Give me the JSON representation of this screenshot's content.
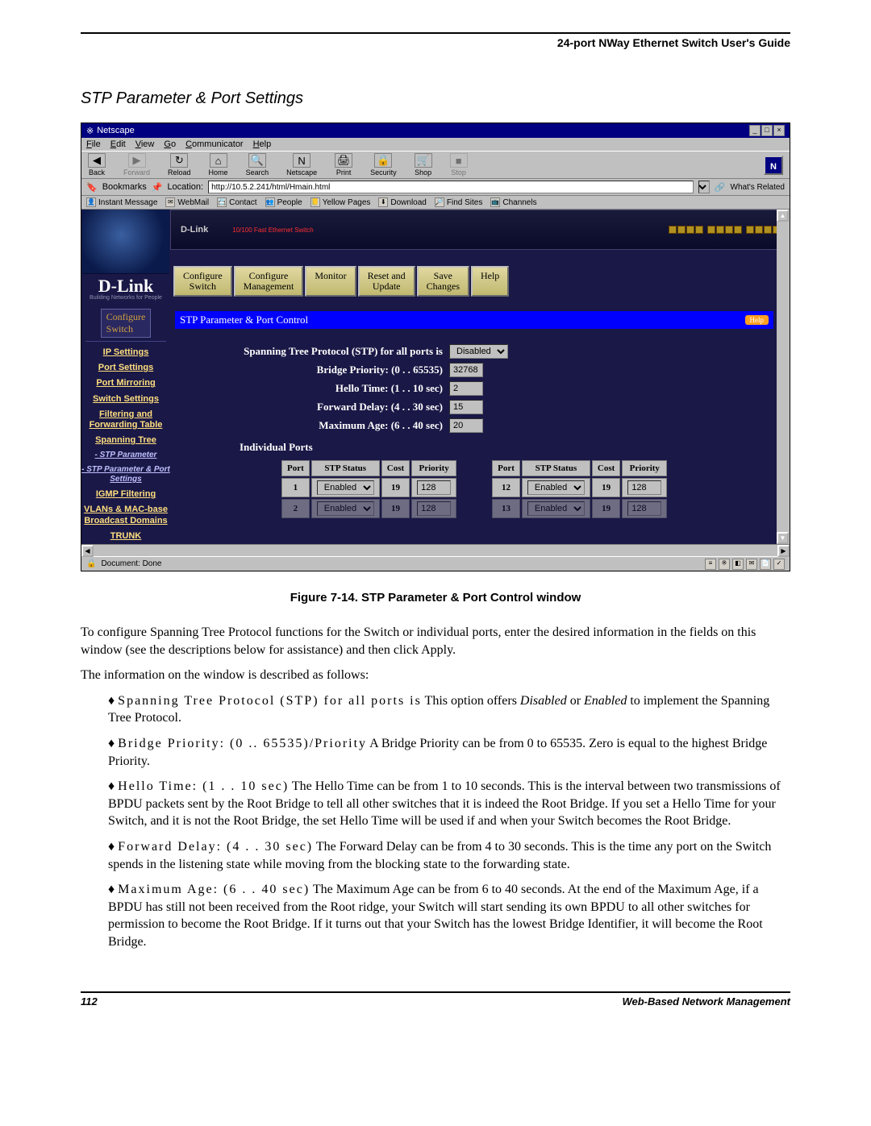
{
  "doc": {
    "header": "24-port NWay Ethernet Switch User's Guide",
    "section_title": "STP Parameter & Port Settings",
    "caption": "Figure 7-14.  STP Parameter & Port Control window",
    "para1": "To configure Spanning Tree Protocol functions for the Switch or individual ports, enter the desired information in the fields on this window (see the descriptions below for assistance) and then click Apply.",
    "para2": "The information on the window is described as follows:",
    "bullets": [
      {
        "term": "Spanning Tree Protocol (STP) for all ports is",
        "rest": "  This option offers Disabled or Enabled to implement the Spanning Tree Protocol.",
        "em1": "Disabled",
        "em2": "Enabled"
      },
      {
        "term": "Bridge Priority: (0 .. 65535)/Priority",
        "rest": "  A Bridge Priority can be from 0 to 65535. Zero is equal to the highest Bridge Priority."
      },
      {
        "term": "Hello Time: (1 . . 10 sec)",
        "rest": "  The Hello Time can be from 1 to 10 seconds. This is the interval between two transmissions of BPDU packets sent by the Root Bridge to tell all other switches that it is indeed the Root Bridge. If you set a Hello Time for your Switch, and it is not the Root Bridge, the set Hello Time will be used if and when your Switch becomes the Root Bridge."
      },
      {
        "term": "Forward Delay: (4 . . 30 sec)",
        "rest": "  The Forward Delay can be from 4 to 30 seconds. This is the time any port on the Switch spends in the listening state while moving from the blocking state to the forwarding state."
      },
      {
        "term": "Maximum Age: (6 . . 40 sec)",
        "rest": "  The Maximum Age can be from 6 to 40 seconds. At the end of the Maximum Age, if a BPDU has still not been received from the Root ridge, your Switch will start sending its own BPDU to all other switches for permission to become the Root Bridge. If it turns out that your Switch has the lowest Bridge Identifier, it will become the Root Bridge."
      }
    ],
    "footer_page": "112",
    "footer_right": "Web-Based Network Management"
  },
  "win": {
    "title": "Netscape",
    "menu": [
      "File",
      "Edit",
      "View",
      "Go",
      "Communicator",
      "Help"
    ],
    "tools": [
      {
        "label": "Back",
        "icon": "◀"
      },
      {
        "label": "Forward",
        "icon": "▶"
      },
      {
        "label": "Reload",
        "icon": "↻"
      },
      {
        "label": "Home",
        "icon": "⌂"
      },
      {
        "label": "Search",
        "icon": "🔍"
      },
      {
        "label": "Netscape",
        "icon": "N"
      },
      {
        "label": "Print",
        "icon": "🖨"
      },
      {
        "label": "Security",
        "icon": "🔒"
      },
      {
        "label": "Shop",
        "icon": "🛒"
      },
      {
        "label": "Stop",
        "icon": "■"
      }
    ],
    "bookmarks": "Bookmarks",
    "loc_label": "Location:",
    "loc_value": "http://10.5.2.241/html/Hmain.html",
    "related": "What's Related",
    "linkbar": [
      "Instant Message",
      "WebMail",
      "Contact",
      "People",
      "Yellow Pages",
      "Download",
      "Find Sites",
      "Channels"
    ],
    "status": "Document: Done"
  },
  "page": {
    "brand": "D-Link",
    "tagline": "Building Networks for People",
    "top_btn": "Configure\nSwitch",
    "side": [
      "IP Settings",
      "Port Settings",
      "Port Mirroring",
      "Switch Settings",
      "Filtering and Forwarding Table",
      "Spanning Tree"
    ],
    "side_sub": [
      "- STP Parameter",
      "- STP Parameter & Port Settings"
    ],
    "side_rest": [
      "IGMP Filtering",
      "VLANs & MAC-base Broadcast Domains",
      "TRUNK"
    ],
    "tabs": [
      "Configure Switch",
      "Configure Management",
      "Monitor",
      "Reset and Update",
      "Save Changes",
      "Help"
    ],
    "panel_title": "STP Parameter & Port Control",
    "help": "Help",
    "stp_label": "Spanning Tree Protocol (STP) for all ports is",
    "stp_val": "Disabled",
    "bp_label": "Bridge Priority: (0 . . 65535)",
    "bp_val": "32768",
    "ht_label": "Hello Time: (1 . . 10 sec)",
    "ht_val": "2",
    "fd_label": "Forward Delay: (4 . . 30 sec)",
    "fd_val": "15",
    "ma_label": "Maximum Age: (6 . . 40 sec)",
    "ma_val": "20",
    "ind": "Individual Ports",
    "th": [
      "Port",
      "STP Status",
      "Cost",
      "Priority"
    ],
    "rows": [
      {
        "p1": "1",
        "s1": "Enabled",
        "c1": "19",
        "pr1": "128",
        "p2": "12",
        "s2": "Enabled",
        "c2": "19",
        "pr2": "128"
      },
      {
        "p1": "2",
        "s1": "Enabled",
        "c1": "19",
        "pr1": "128",
        "p2": "13",
        "s2": "Enabled",
        "c2": "19",
        "pr2": "128"
      }
    ],
    "device_label": "10/100 Fast Ethernet Switch"
  }
}
